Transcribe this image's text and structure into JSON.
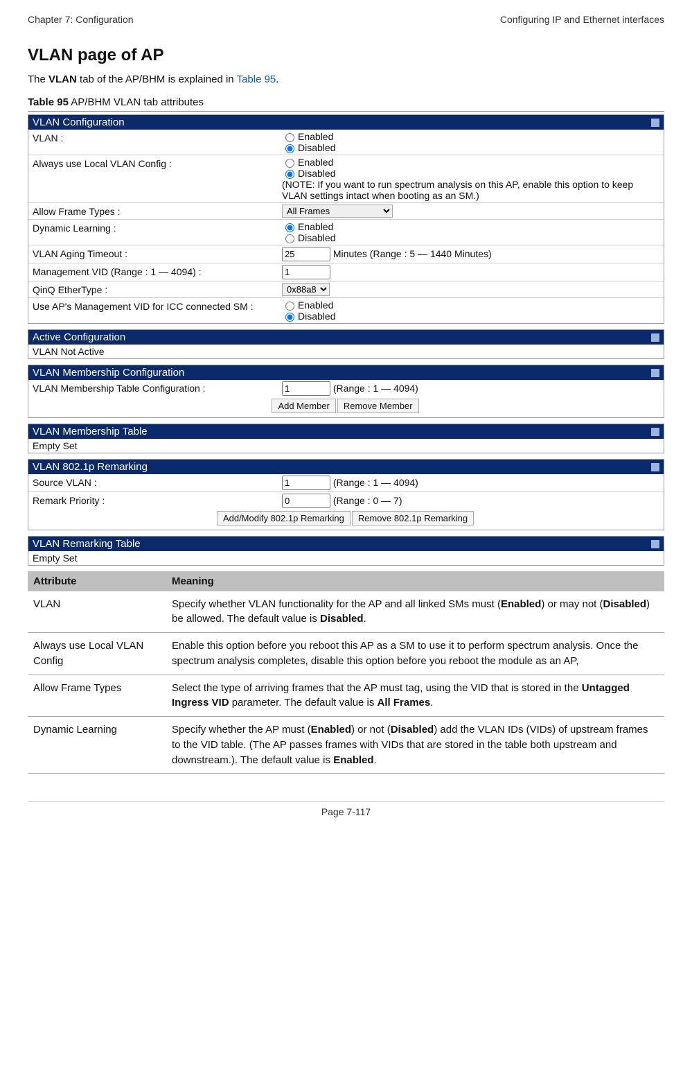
{
  "header": {
    "left": "Chapter 7:  Configuration",
    "right": "Configuring IP and Ethernet interfaces"
  },
  "title": "VLAN page of AP",
  "intro": {
    "prefix": "The ",
    "bold1": "VLAN",
    "mid": " tab of the AP/BHM is explained in ",
    "link": "Table 95",
    "suffix": "."
  },
  "table_caption": {
    "bold": "Table 95",
    "rest": " AP/BHM VLAN tab attributes"
  },
  "panels": {
    "vlan_config": {
      "title": "VLAN Configuration",
      "rows": {
        "vlan": {
          "label": "VLAN :",
          "opt_enabled": "Enabled",
          "opt_disabled": "Disabled",
          "selected": "disabled"
        },
        "always_local": {
          "label": "Always use Local VLAN Config :",
          "opt_enabled": "Enabled",
          "opt_disabled": "Disabled",
          "selected": "disabled",
          "note": "(NOTE: If you want to run spectrum analysis on this AP, enable this option to keep VLAN settings intact when booting as an SM.)"
        },
        "allow_frame": {
          "label": "Allow Frame Types :",
          "value": "All Frames"
        },
        "dyn_learn": {
          "label": "Dynamic Learning :",
          "opt_enabled": "Enabled",
          "opt_disabled": "Disabled",
          "selected": "enabled"
        },
        "aging": {
          "label": "VLAN Aging Timeout :",
          "value": "25",
          "suffix": "Minutes (Range : 5 — 1440 Minutes)"
        },
        "mgmt_vid": {
          "label": "Management VID (Range : 1 — 4094) :",
          "value": "1"
        },
        "qinq": {
          "label": "QinQ EtherType :",
          "value": "0x88a8"
        },
        "icc": {
          "label": "Use AP's Management VID for ICC connected SM :",
          "opt_enabled": "Enabled",
          "opt_disabled": "Disabled",
          "selected": "disabled"
        }
      }
    },
    "active_config": {
      "title": "Active Configuration",
      "body": "VLAN Not Active"
    },
    "membership_config": {
      "title": "VLAN Membership Configuration",
      "label": "VLAN Membership Table Configuration :",
      "value": "1",
      "suffix": "(Range : 1 — 4094)",
      "btn_add": "Add Member",
      "btn_remove": "Remove Member"
    },
    "membership_table": {
      "title": "VLAN Membership Table",
      "body": "Empty Set"
    },
    "remarking": {
      "title": "VLAN 802.1p Remarking",
      "src": {
        "label": "Source VLAN :",
        "value": "1",
        "suffix": "(Range : 1 — 4094)"
      },
      "prio": {
        "label": "Remark Priority :",
        "value": "0",
        "suffix": "(Range : 0 — 7)"
      },
      "btn_add": "Add/Modify 802.1p Remarking",
      "btn_remove": "Remove 802.1p Remarking"
    },
    "remarking_table": {
      "title": "VLAN Remarking Table",
      "body": "Empty Set"
    }
  },
  "attr_table": {
    "headers": {
      "attr": "Attribute",
      "meaning": "Meaning"
    },
    "rows": [
      {
        "attr": "VLAN",
        "meaning_parts": [
          "Specify whether VLAN functionality for the AP and all linked SMs must (",
          "Enabled",
          ") or may not (",
          "Disabled",
          ") be allowed. The default value is ",
          "Disabled",
          "."
        ]
      },
      {
        "attr": "Always use Local VLAN Config",
        "meaning": "Enable this option before you reboot this AP as a SM to use it to perform spectrum analysis. Once the spectrum analysis completes, disable this option before you reboot the module as an AP,"
      },
      {
        "attr": "Allow Frame Types",
        "meaning_parts": [
          "Select the type of arriving frames that the AP must tag, using the VID that is stored in the ",
          "Untagged Ingress VID",
          " parameter. The default value is ",
          "All Frames",
          "."
        ]
      },
      {
        "attr": "Dynamic Learning",
        "meaning_parts": [
          "Specify whether the AP must (",
          "Enabled",
          ") or not (",
          "Disabled",
          ") add the VLAN IDs (VIDs) of upstream frames to the VID table. (The AP passes frames with VIDs that are stored in the table both upstream and downstream.). The default value is ",
          "Enabled",
          "."
        ]
      }
    ]
  },
  "footer": "Page 7-117"
}
